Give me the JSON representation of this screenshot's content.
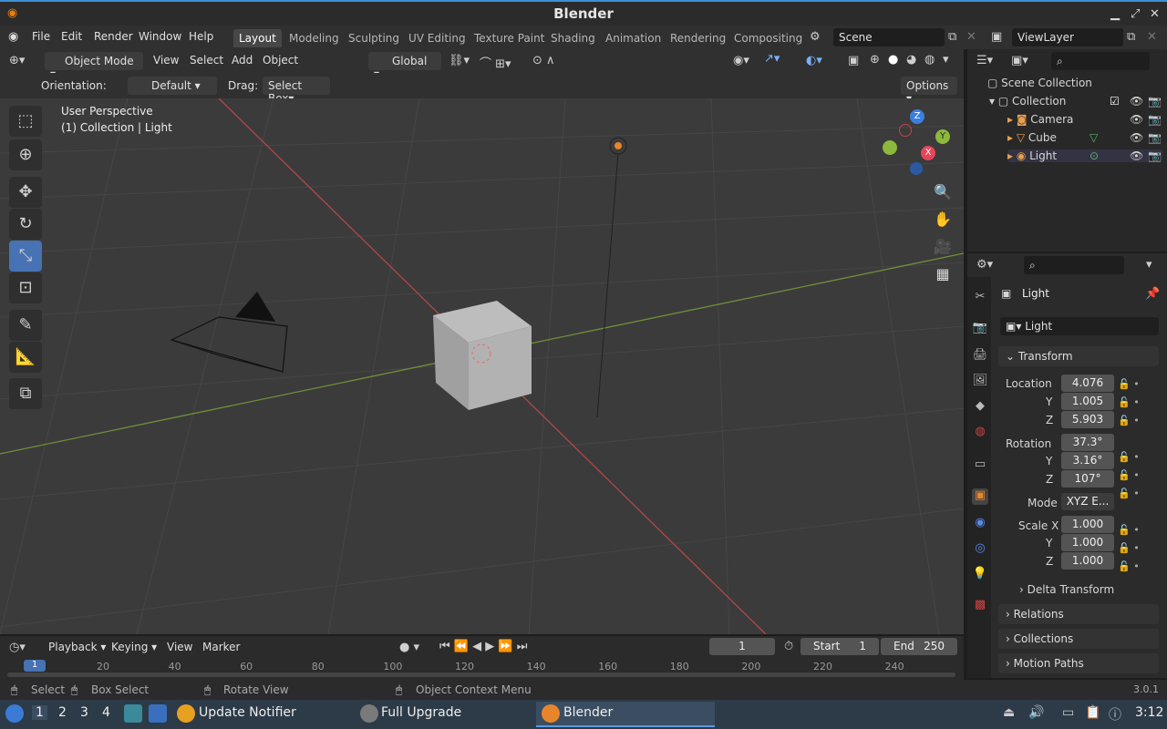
{
  "window": {
    "title": "Blender"
  },
  "menus": [
    "File",
    "Edit",
    "Render",
    "Window",
    "Help"
  ],
  "workspaces": [
    "Layout",
    "Modeling",
    "Sculpting",
    "UV Editing",
    "Texture Paint",
    "Shading",
    "Animation",
    "Rendering",
    "Compositing"
  ],
  "scene": "Scene",
  "view_layer": "ViewLayer",
  "header": {
    "mode": "Object Mode",
    "view": "View",
    "select": "Select",
    "add": "Add",
    "object": "Object",
    "transform": "Global"
  },
  "tool_settings": {
    "orientation_label": "Orientation:",
    "orientation": "Default",
    "drag_label": "Drag:",
    "drag": "Select Box",
    "options": "Options"
  },
  "viewport": {
    "overlay_line1": "User Perspective",
    "overlay_line2": "(1) Collection | Light"
  },
  "gizmo": {
    "x": "X",
    "y": "Y",
    "z": "Z"
  },
  "outliner": {
    "root": "Scene Collection",
    "collection": "Collection",
    "items": [
      "Camera",
      "Cube",
      "Light"
    ]
  },
  "properties": {
    "object_name": "Light",
    "data_name": "Light",
    "transform": "Transform",
    "location_label": "Location",
    "rotation_label": "Rotation",
    "mode_label": "Mode",
    "scale_label": "Scale X",
    "y": "Y",
    "z": "Z",
    "location": [
      "4.076",
      "1.005",
      "5.903"
    ],
    "rotation": [
      "37.3°",
      "3.16°",
      "107°"
    ],
    "mode": "XYZ E...",
    "scale": [
      "1.000",
      "1.000",
      "1.000"
    ],
    "panels": [
      "Delta Transform",
      "Relations",
      "Collections",
      "Motion Paths"
    ]
  },
  "timeline": {
    "playback": "Playback",
    "keying": "Keying",
    "view": "View",
    "marker": "Marker",
    "frame": "1",
    "start_label": "Start",
    "start": "1",
    "end_label": "End",
    "end": "250",
    "ticks": [
      "20",
      "40",
      "60",
      "80",
      "100",
      "120",
      "140",
      "160",
      "180",
      "200",
      "220",
      "240"
    ],
    "current": "1"
  },
  "status": {
    "select": "Select",
    "box_select": "Box Select",
    "rotate": "Rotate View",
    "context": "Object Context Menu",
    "version": "3.0.1"
  },
  "taskbar": {
    "desktops": [
      "1",
      "2",
      "3",
      "4"
    ],
    "apps": [
      "Update Notifier",
      "Full Upgrade",
      "Blender"
    ],
    "clock": "3:12"
  }
}
